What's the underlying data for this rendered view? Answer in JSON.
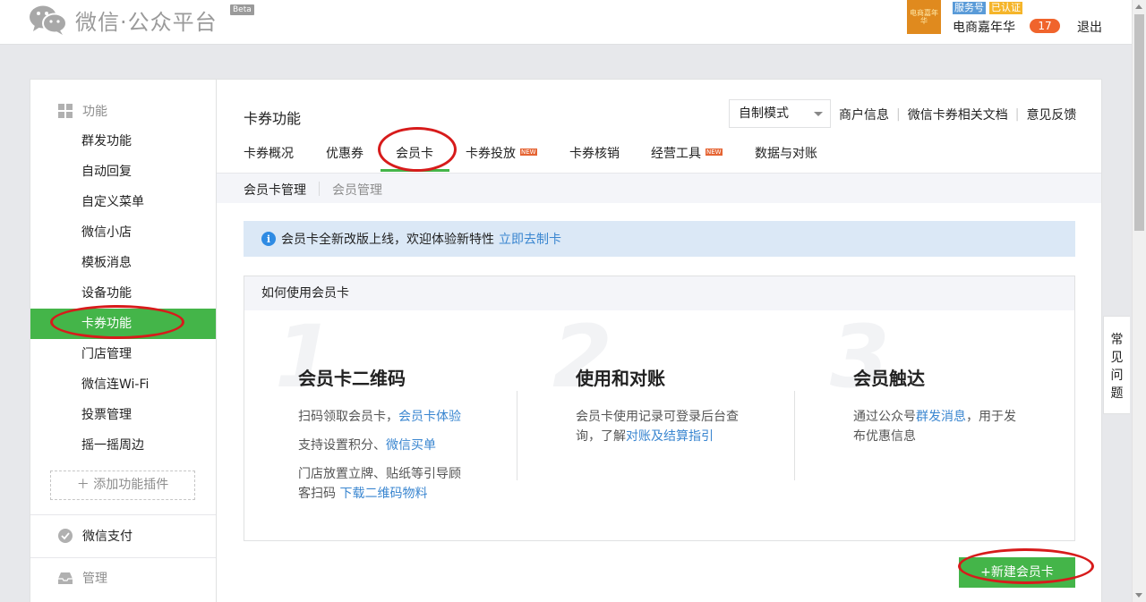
{
  "header": {
    "logo_text": "微信·公众平台",
    "beta": "Beta",
    "avatar_text": "电商嘉年华",
    "tag_service": "服务号",
    "tag_verified": "已认证",
    "account_name": "电商嘉年华",
    "notification_count": "17",
    "logout": "退出"
  },
  "sidebar": {
    "group_functions": "功能",
    "items": [
      "群发功能",
      "自动回复",
      "自定义菜单",
      "微信小店",
      "模板消息",
      "设备功能",
      "卡券功能",
      "门店管理",
      "微信连Wi-Fi",
      "投票管理",
      "摇一摇周边"
    ],
    "active_index": 6,
    "add_plugin": "添加功能插件",
    "group_pay": "微信支付",
    "group_manage": "管理"
  },
  "main": {
    "title": "卡券功能",
    "mode_select": "自制模式",
    "links": [
      "商户信息",
      "微信卡券相关文档",
      "意见反馈"
    ],
    "tabs": [
      {
        "label": "卡券概况",
        "new": false
      },
      {
        "label": "优惠券",
        "new": false
      },
      {
        "label": "会员卡",
        "new": false
      },
      {
        "label": "卡券投放",
        "new": true
      },
      {
        "label": "卡券核销",
        "new": false
      },
      {
        "label": "经营工具",
        "new": true
      },
      {
        "label": "数据与对账",
        "new": false
      }
    ],
    "new_badge": "NEW",
    "active_tab": "会员卡",
    "subnav": [
      "会员卡管理",
      "会员管理"
    ],
    "notice_text": "会员卡全新改版上线，欢迎体验新特性",
    "notice_link": "立即去制卡",
    "howto_title": "如何使用会员卡",
    "steps": [
      {
        "num": "1",
        "title": "会员卡二维码",
        "line1_text": "扫码领取会员卡，",
        "line1_link": "会员卡体验",
        "line2_text": "支持设置积分、",
        "line2_link": "微信买单",
        "line3_text_a": "门店放置立牌、贴纸等引导顾",
        "line3_text_b": "客扫码 ",
        "line3_link": "下载二维码物料"
      },
      {
        "num": "2",
        "title": "使用和对账",
        "line1_text": "会员卡使用记录可登录后台查",
        "line2_text": "询，了解",
        "line2_link": "对账及结算指引"
      },
      {
        "num": "3",
        "title": "会员触达",
        "line1_text": "通过公众号",
        "line1_link": "群发消息",
        "line1_tail": "，用于发",
        "line2_text": "布优惠信息"
      }
    ],
    "new_card_button": "+新建会员卡"
  },
  "side_help": [
    "常",
    "见",
    "问",
    "题"
  ],
  "colors": {
    "accent_green": "#44b549",
    "link_blue": "#3a86d0",
    "annotation_red": "#d71b1b",
    "badge_orange": "#f0642c"
  }
}
